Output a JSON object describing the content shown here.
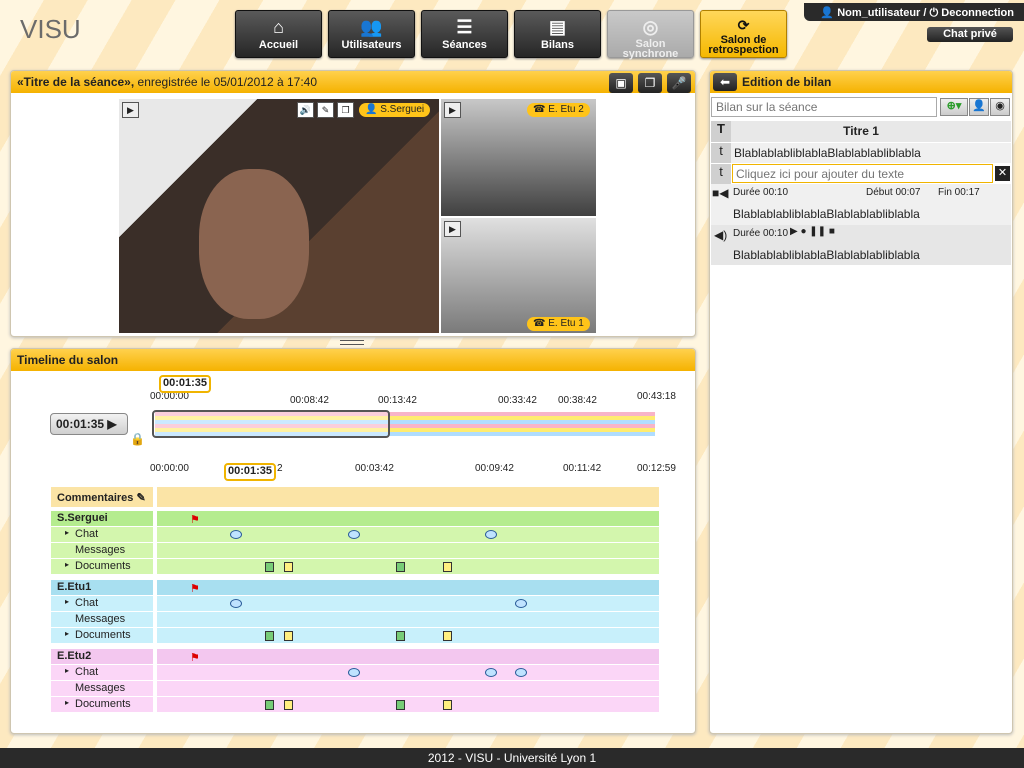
{
  "app": {
    "logo": "VISU",
    "footer": "2012 - VISU - Université Lyon 1"
  },
  "user": {
    "label": "Nom_utilisateur /",
    "logout": "Deconnection",
    "chat_private": "Chat privé"
  },
  "nav": [
    {
      "label": "Accueil",
      "icon": "home-icon"
    },
    {
      "label": "Utilisateurs",
      "icon": "users-icon"
    },
    {
      "label": "Séances",
      "icon": "list-icon"
    },
    {
      "label": "Bilans",
      "icon": "report-icon"
    },
    {
      "label": "Salon\nsynchrone",
      "icon": "sync-icon"
    },
    {
      "label": "Salon de\nretrospection",
      "icon": "refresh-icon"
    }
  ],
  "session": {
    "title_strong": "«Titre de la séance»,",
    "title_rest": " enregistrée le 05/01/2012 à 17:40",
    "main_user": "S.Serguei",
    "tag2": "E. Etu 2",
    "tag1": "E. Etu 1"
  },
  "timeline": {
    "title": "Timeline du salon",
    "current": "00:01:35",
    "top_ticks": [
      "00:00:00",
      "00:08:42",
      "00:13:42",
      "00:33:42",
      "00:38:42",
      "00:43:18"
    ],
    "bottom_ticks": [
      "00:00:00",
      "00:03:42",
      "00:09:42",
      "00:11:42",
      "00:12:59"
    ],
    "top_bubble": "00:01:35",
    "bottom_bubble": "00:01:35",
    "bottom_partial": "2",
    "comments": "Commentaires",
    "groups": [
      {
        "name": "S.Serguei",
        "color": "#b5ec8f",
        "light": "#d3f6ad"
      },
      {
        "name": "E.Etu1",
        "color": "#a8dff0",
        "light": "#c8f0fb"
      },
      {
        "name": "E.Etu2",
        "color": "#f3c7ef",
        "light": "#fbd6f7"
      }
    ],
    "subrows": [
      "Chat",
      "Messages",
      "Documents"
    ]
  },
  "bilan": {
    "title": "Edition de bilan",
    "placeholder": "Bilan sur la séance",
    "title1": "Titre 1",
    "text1": "BlablablabliblablaBlablablabliblabla",
    "add_text": "Cliquez ici pour ajouter du texte",
    "video_duration": "Durée 00:10",
    "debut": "Début 00:07",
    "fin": "Fin 00:17",
    "video_text": "BlablablabliblablaBlablablabliblabla",
    "audio_duration": "Durée 00:10",
    "audio_text": "BlablablabliblablaBlablablabliblabla",
    "row_t1": "T",
    "row_t2": "t",
    "row_t3": "t"
  }
}
